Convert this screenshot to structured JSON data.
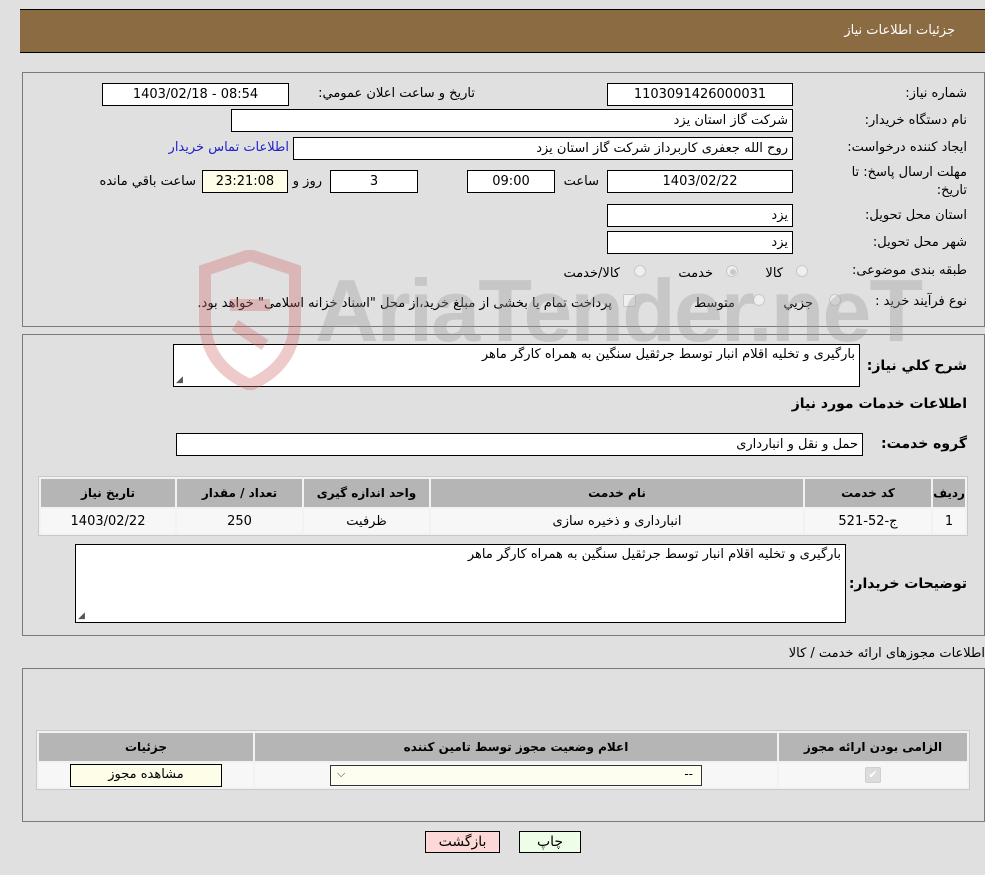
{
  "header": {
    "title": "جزئیات اطلاعات نیاز"
  },
  "colors": {
    "header_bg": "#8b6b42",
    "link": "#2222cc",
    "print_btn_bg": "#eefde8",
    "back_btn_bg": "#fdd8d8"
  },
  "details": {
    "need_number": {
      "label": "شماره نیاز:",
      "value": "1103091426000031"
    },
    "announce": {
      "label": "تاریخ و ساعت اعلان عمومي:",
      "value": "1403/02/18 - 08:54"
    },
    "buyer_org": {
      "label": "نام دستگاه خریدار:",
      "value": "شرکت گاز استان یزد"
    },
    "requester": {
      "label": "ایجاد کننده درخواست:",
      "value": "روح الله جعفری کاربرداز شرکت گاز استان یزد",
      "contact_link": "اطلاعات تماس خریدار"
    },
    "deadline": {
      "label_line1": "مهلت ارسال پاسخ: تا",
      "label_line2": "تاریخ:",
      "date": "1403/02/22",
      "time_label": "ساعت",
      "time": "09:00",
      "days": "3",
      "days_label": "روز و",
      "remaining": "23:21:08",
      "remaining_label": "ساعت باقي مانده"
    },
    "province": {
      "label": "استان محل تحویل:",
      "value": "یزد"
    },
    "city": {
      "label": "شهر محل تحویل:",
      "value": "یزد"
    },
    "category": {
      "label": "طبقه بندی موضوعی:",
      "options": [
        {
          "label": "کالا",
          "checked": false
        },
        {
          "label": "خدمت",
          "checked": true
        },
        {
          "label": "کالا/خدمت",
          "checked": false
        }
      ]
    },
    "process": {
      "label": "نوع فرآیند خرید :",
      "options": [
        {
          "label": "جزیي",
          "checked": false
        },
        {
          "label": "متوسط",
          "checked": false
        }
      ],
      "treasury_note": "پرداخت تمام یا بخشی از مبلغ خرید،از محل \"اسناد خزانه اسلامی\" خواهد بود."
    }
  },
  "description": {
    "label": "شرح کلي نیاز:",
    "value": "بارگیری و تخلیه اقلام انبار توسط جرثقیل سنگین به همراه کارگر ماهر"
  },
  "services": {
    "section_title": "اطلاعات خدمات مورد نیاز",
    "group_label": "گروه خدمت:",
    "group_value": "حمل و نقل و انبارداری",
    "table": {
      "headers": [
        "ردیف",
        "کد خدمت",
        "نام خدمت",
        "واحد اندازه گیری",
        "تعداد / مقدار",
        "تاریخ نیاز"
      ],
      "rows": [
        [
          "1",
          "ج-52-521",
          "انبارداری و ذخیره سازی",
          "ظرفیت",
          "250",
          "1403/02/22"
        ]
      ]
    },
    "buyer_notes_label": "توضیحات خریدار:",
    "buyer_notes": "بارگیری و تخلیه اقلام انبار توسط جرثقیل سنگین به همراه کارگر ماهر"
  },
  "permits": {
    "section_title": "اطلاعات مجوزهای ارائه خدمت / کالا",
    "headers": [
      "الزامی بودن ارائه مجوز",
      "اعلام وضعیت مجوز توسط تامین کننده",
      "جزئیات"
    ],
    "rows": [
      {
        "required": true,
        "status_value": "--",
        "details_button": "مشاهده مجوز"
      }
    ]
  },
  "buttons": {
    "print": "چاپ",
    "back": "بازگشت"
  },
  "watermark": {
    "text": "AriaTender.neT"
  }
}
